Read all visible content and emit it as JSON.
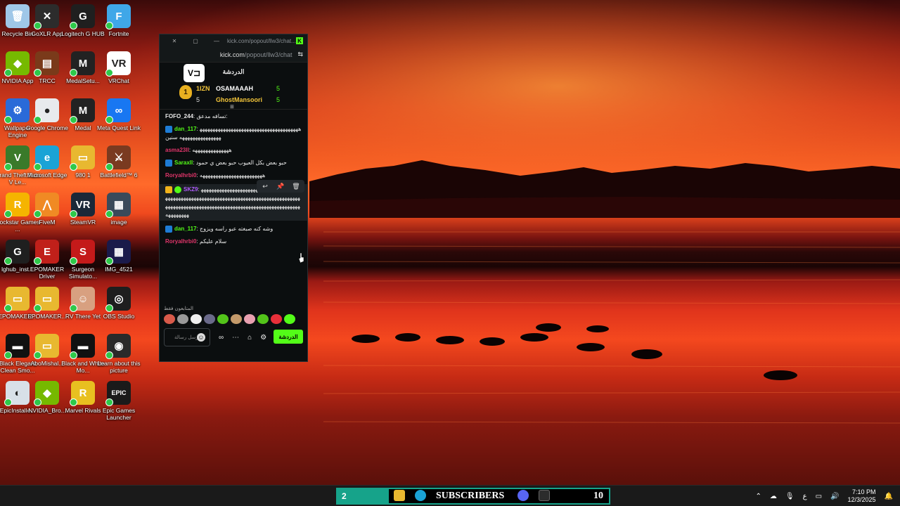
{
  "desktop": {
    "icons": [
      {
        "label": "Recycle Bin",
        "color": "#9fc7e8",
        "glyph": "🗑"
      },
      {
        "label": "GoXLR App",
        "color": "#2c2c2c",
        "glyph": "✕"
      },
      {
        "label": "Logitech G HUB",
        "color": "#1f1f1f",
        "glyph": "G"
      },
      {
        "label": "Fortnite",
        "color": "#3fa7e8",
        "glyph": "F"
      },
      {
        "label": "NVIDIA App",
        "color": "#76b900",
        "glyph": "◆"
      },
      {
        "label": "TRCC",
        "color": "#7a3a1a",
        "glyph": "▤"
      },
      {
        "label": "MedalSetu...",
        "color": "#222222",
        "glyph": "M"
      },
      {
        "label": "VRChat",
        "color": "#ffffff",
        "glyph": "VR"
      },
      {
        "label": "Wallpaper Engine",
        "color": "#2a6ad8",
        "glyph": "⚙"
      },
      {
        "label": "Google Chrome",
        "color": "#e8eaed",
        "glyph": "●"
      },
      {
        "label": "Medal",
        "color": "#222222",
        "glyph": "M"
      },
      {
        "label": "Meta Quest Link",
        "color": "#1877f2",
        "glyph": "∞"
      },
      {
        "label": "Grand Theft Auto V Le...",
        "color": "#3a7a2a",
        "glyph": "V"
      },
      {
        "label": "Microsoft Edge",
        "color": "#1aa3d6",
        "glyph": "e"
      },
      {
        "label": "980 1",
        "color": "#e8b830",
        "glyph": "▭"
      },
      {
        "label": "Battlefield™ 6",
        "color": "#7a3a20",
        "glyph": "⚔"
      },
      {
        "label": "Rockstar Games ...",
        "color": "#f5b400",
        "glyph": "R"
      },
      {
        "label": "FiveM",
        "color": "#f08a24",
        "glyph": "⋀"
      },
      {
        "label": "SteamVR",
        "color": "#1b2838",
        "glyph": "VR"
      },
      {
        "label": "image",
        "color": "#3a4a5a",
        "glyph": "▦"
      },
      {
        "label": "lghub_inst...",
        "color": "#1f1f1f",
        "glyph": "G"
      },
      {
        "label": "EPOMAKER Driver",
        "color": "#c0201a",
        "glyph": "E"
      },
      {
        "label": "Surgeon Simulato...",
        "color": "#c41a1a",
        "glyph": "S"
      },
      {
        "label": "IMG_4521",
        "color": "#1a1a4a",
        "glyph": "▦"
      },
      {
        "label": "EPOMAKER...",
        "color": "#e8b830",
        "glyph": "▭"
      },
      {
        "label": "EPOMAKER...",
        "color": "#e8b830",
        "glyph": "▭"
      },
      {
        "label": "RV There Yet",
        "color": "#d8a080",
        "glyph": "☺"
      },
      {
        "label": "OBS Studio",
        "color": "#1e1e1e",
        "glyph": "◎"
      },
      {
        "label": "Black Elegant Clean Smo...",
        "color": "#111111",
        "glyph": "▬"
      },
      {
        "label": "AboMishal...",
        "color": "#e8b830",
        "glyph": "▭"
      },
      {
        "label": "Black and White Mo...",
        "color": "#111111",
        "glyph": "▬"
      },
      {
        "label": "Learn about this picture",
        "color": "#2a2a2a",
        "glyph": "◉"
      },
      {
        "label": "EpicInstalle...",
        "color": "#d8e0e8",
        "glyph": "◐"
      },
      {
        "label": "NVIDIA_Bro...",
        "color": "#76b900",
        "glyph": "◆"
      },
      {
        "label": "Marvel Rivals",
        "color": "#e8c020",
        "glyph": "R"
      },
      {
        "label": "Epic Games Launcher",
        "color": "#1a1a1a",
        "glyph": "EPIC"
      }
    ]
  },
  "chat_window": {
    "title": "kick.com/popout/llw3/chat...",
    "url_host": "kick.com",
    "url_path": "/popout/llw3/chat",
    "header_title": "الدردشة",
    "channel_logo": "V⊐",
    "leaderboard": {
      "rank": "1",
      "first_name": "1IZN",
      "first_count": "5",
      "user_1": "OSAMAAAH",
      "user_1_count": "5",
      "user_2": "GhostMansoori",
      "user_2_count": "5"
    },
    "messages": [
      {
        "user": "FOFO_244",
        "text": "تسافه مدعق:",
        "color": "#e8e8e8",
        "badge": "none"
      },
      {
        "user": "dan_117",
        "text": "ههههههههههههههههههههههههههههههههههههههههههههههههههههههه سنين",
        "color": "#53fc18",
        "badge": "kick"
      },
      {
        "user": "asma23ll",
        "text": "ههههههههههههههه",
        "color": "#e0356a",
        "badge": "none"
      },
      {
        "user": "Saraxll",
        "text": "حبو بعض بكل العيوب حبو بعض ي حمود",
        "color": "#53fc18",
        "badge": "kick"
      },
      {
        "user": "Roryalhrbi0",
        "text": "ههههههههههههههههههههههههه",
        "color": "#e0356a",
        "badge": "none"
      },
      {
        "user": "SKZ9",
        "text": "ههههههههههههههههههههههههههههههههههههههههههههههههههههههههههههههههههههههههههههههههههههههههههههههههههههههههههههههههههههههههههههههههههههههههههههههههههههههه",
        "color": "#b05cff",
        "badge": "crown"
      },
      {
        "user": "dan_117",
        "text": "وشه كنه صبغته عبو راسه ويزوج",
        "color": "#53fc18",
        "badge": "kick"
      },
      {
        "user": "Roryalhrbi0",
        "text": "سلام عليكم",
        "color": "#e0356a",
        "badge": "none"
      }
    ],
    "emote_label": "المتابعون فقط",
    "input_placeholder": "ارسل رسالة",
    "send_label": "الدردشة"
  },
  "taskbar": {
    "subs_left_count": "2",
    "subs_title": "SUBSCRIBERS",
    "subs_right_count": "10",
    "tray_lang": "ع",
    "time": "7:10 PM",
    "date": "12/3/2025"
  }
}
